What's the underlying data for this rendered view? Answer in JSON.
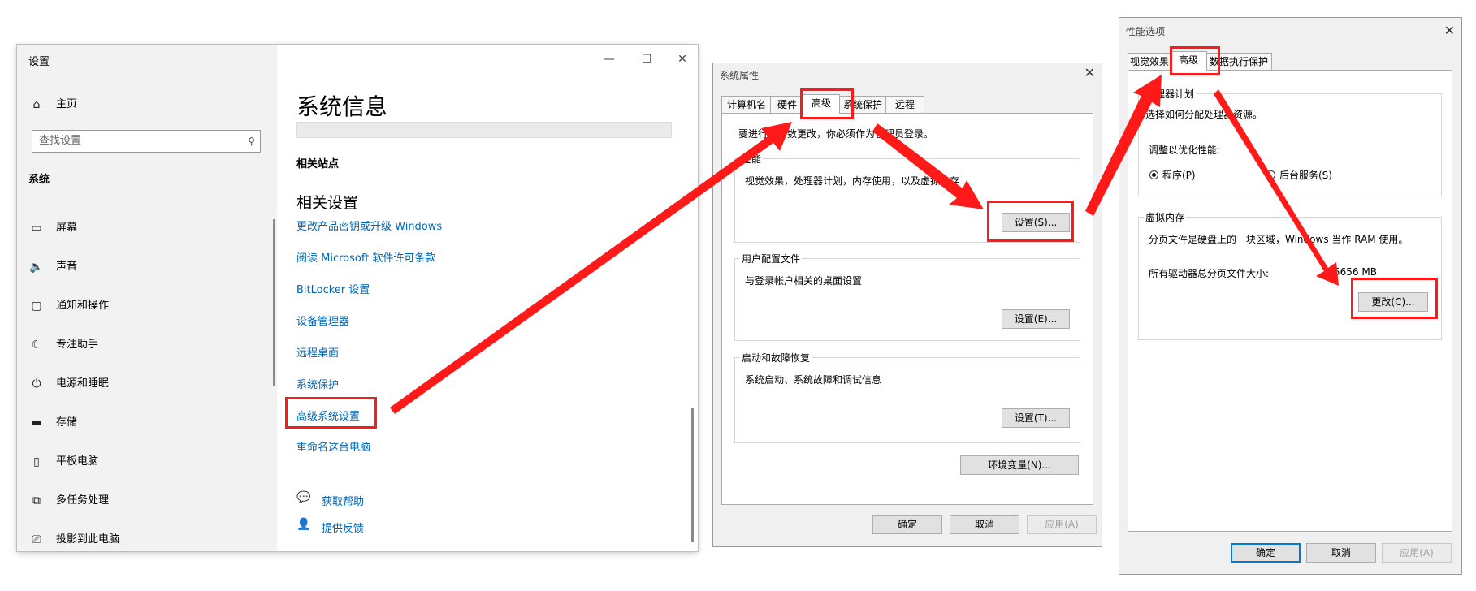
{
  "settings": {
    "window_title": "设置",
    "nav": {
      "home": "主页",
      "search_placeholder": "查找设置",
      "category": "系统",
      "items": [
        {
          "label": "屏幕",
          "icon": "monitor-icon"
        },
        {
          "label": "声音",
          "icon": "speaker-icon"
        },
        {
          "label": "通知和操作",
          "icon": "notification-icon"
        },
        {
          "label": "专注助手",
          "icon": "moon-icon"
        },
        {
          "label": "电源和睡眠",
          "icon": "power-icon"
        },
        {
          "label": "存储",
          "icon": "storage-icon"
        },
        {
          "label": "平板电脑",
          "icon": "tablet-icon"
        },
        {
          "label": "多任务处理",
          "icon": "multitask-icon"
        },
        {
          "label": "投影到此电脑",
          "icon": "project-icon"
        }
      ]
    },
    "main": {
      "title": "系统信息",
      "related_sites": "相关站点",
      "related_settings": "相关设置",
      "links": [
        "更改产品密钥或升级 Windows",
        "阅读 Microsoft 软件许可条款",
        "BitLocker 设置",
        "设备管理器",
        "远程桌面",
        "系统保护",
        "高级系统设置",
        "重命名这台电脑"
      ],
      "help": "获取帮助",
      "feedback": "提供反馈"
    }
  },
  "sysprops": {
    "title": "系统属性",
    "tabs": [
      "计算机名",
      "硬件",
      "高级",
      "系统保护",
      "远程"
    ],
    "active_tab": "高级",
    "admin_note": "要进行大多数更改，你必须作为管理员登录。",
    "perf_label": "性能",
    "perf_desc": "视觉效果，处理器计划，内存使用，以及虚拟内存",
    "perf_button": "设置(S)...",
    "profile_label": "用户配置文件",
    "profile_desc": "与登录帐户相关的桌面设置",
    "profile_button": "设置(E)...",
    "startup_label": "启动和故障恢复",
    "startup_desc": "系统启动、系统故障和调试信息",
    "startup_button": "设置(T)...",
    "env_button": "环境变量(N)...",
    "ok": "确定",
    "cancel": "取消",
    "apply": "应用(A)"
  },
  "perfopts": {
    "title": "性能选项",
    "tabs": [
      "视觉效果",
      "高级",
      "数据执行保护"
    ],
    "active_tab": "高级",
    "cpu_label": "处理器计划",
    "cpu_desc": "选择如何分配处理器资源。",
    "adjust_label": "调整以优化性能:",
    "radio_programs": "程序(P)",
    "radio_services": "后台服务(S)",
    "vm_label": "虚拟内存",
    "vm_desc": "分页文件是硬盘上的一块区域，Windows 当作 RAM 使用。",
    "vm_total_label": "所有驱动器总分页文件大小:",
    "vm_total_value": "5656 MB",
    "change_button": "更改(C)...",
    "ok": "确定",
    "cancel": "取消",
    "apply": "应用(A)"
  },
  "colors": {
    "highlight": "#ff1a1a",
    "link": "#0066b4",
    "accent": "#0078d7"
  }
}
